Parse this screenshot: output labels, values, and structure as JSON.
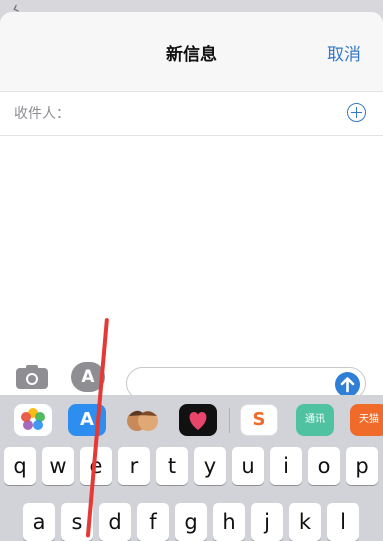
{
  "navbar": {
    "title": "新信息",
    "cancel_label": "取消"
  },
  "recipient": {
    "label": "收件人："
  },
  "compose": {
    "message_placeholder": ""
  },
  "app_drawer": [
    {
      "name": "photos-app-icon",
      "color": "#ffffff"
    },
    {
      "name": "app-store-app-icon",
      "color": "#2d8ef0"
    },
    {
      "name": "memoji-app-icon",
      "color": "#d1d3d9"
    },
    {
      "name": "digital-touch-app-icon",
      "color": "#111111"
    },
    {
      "name": "sogou-app-icon",
      "color": "#ffffff"
    },
    {
      "name": "green-app-icon",
      "color": "#4fc3a1",
      "text": "通讯"
    },
    {
      "name": "orange-app-icon",
      "color": "#f06a2a",
      "text": "天猫"
    }
  ],
  "keyboard": {
    "row1": [
      "q",
      "w",
      "e",
      "r",
      "t",
      "y",
      "u",
      "i",
      "o",
      "p"
    ],
    "row2": [
      "a",
      "s",
      "d",
      "f",
      "g",
      "h",
      "j",
      "k",
      "l"
    ]
  },
  "colors": {
    "accent": "#3478c8",
    "send": "#2f7fd6",
    "annotation": "#e53935"
  }
}
